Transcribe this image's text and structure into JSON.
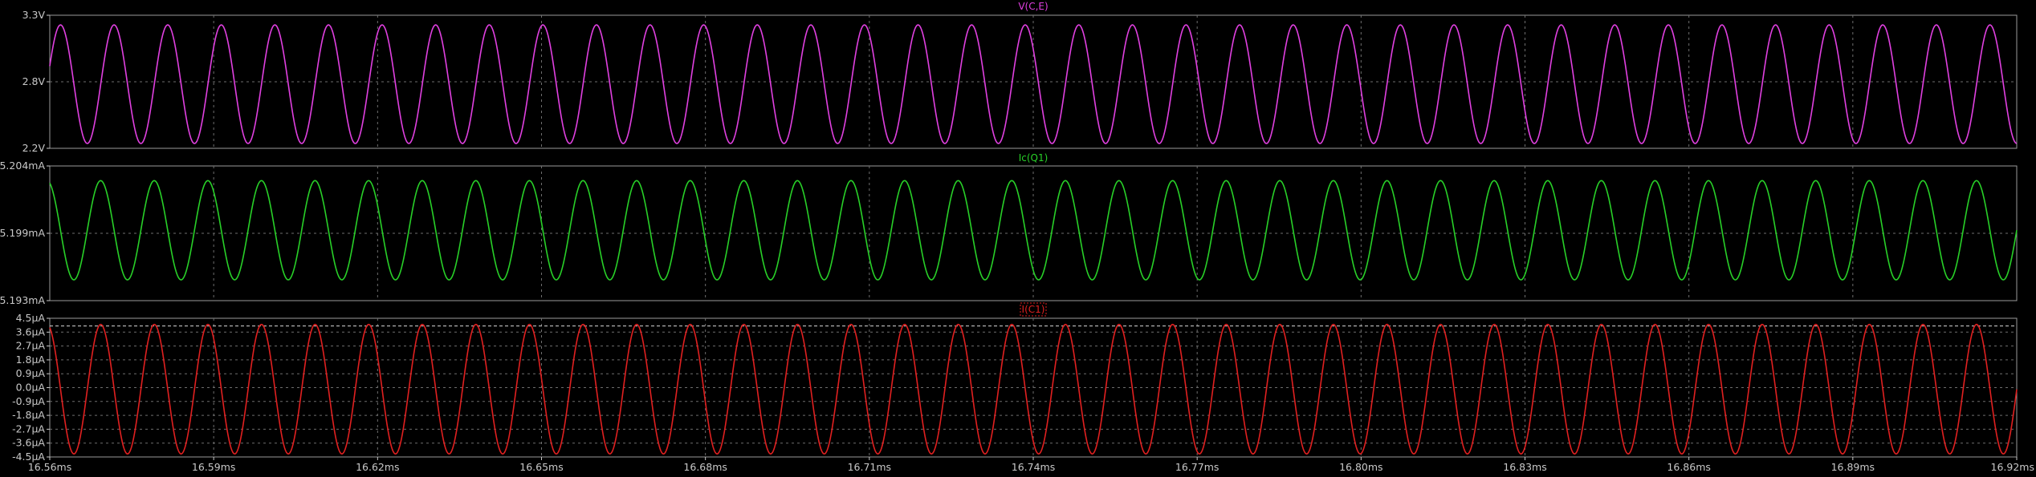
{
  "chart_data": {
    "type": "line",
    "x_ticks": [
      "16.56ms",
      "16.59ms",
      "16.62ms",
      "16.65ms",
      "16.68ms",
      "16.71ms",
      "16.74ms",
      "16.77ms",
      "16.80ms",
      "16.83ms",
      "16.86ms",
      "16.89ms",
      "16.92ms"
    ],
    "x_range_ms": [
      16.56,
      16.92
    ],
    "grid": true,
    "background": "#000000",
    "grid_color": "#6e6e6e",
    "panes": [
      {
        "title": "V(C,E)",
        "color": "#e040e0",
        "y_ticks": [
          "3.3V",
          "2.8V",
          "2.2V"
        ],
        "ylim": [
          2.2,
          3.3
        ],
        "waveform": {
          "shape": "sine",
          "min": 2.24,
          "max": 3.22,
          "cycles": 36.7,
          "start_value": 2.88,
          "start_direction": "up"
        }
      },
      {
        "title": "Ic(Q1)",
        "color": "#28d028",
        "y_ticks": [
          "5.204mA",
          "5.199mA",
          "5.193mA"
        ],
        "ylim": [
          5.193,
          5.204
        ],
        "waveform": {
          "shape": "sine",
          "min": 5.1947,
          "max": 5.2028,
          "cycles": 36.7,
          "start_value": 5.2026,
          "start_direction": "down"
        }
      },
      {
        "title": "I(C1)",
        "color": "#e02020",
        "title_boxed": true,
        "y_ticks": [
          "4.5µA",
          "3.6µA",
          "2.7µA",
          "1.8µA",
          "0.9µA",
          "0.0µA",
          "-0.9µA",
          "-1.8µA",
          "-2.7µA",
          "-3.6µA",
          "-4.5µA"
        ],
        "ylim": [
          -4.5,
          4.5
        ],
        "reference_line": 4.0,
        "waveform": {
          "shape": "sine",
          "min": -4.3,
          "max": 4.1,
          "cycles": 36.7,
          "start_value": 3.9,
          "start_direction": "down"
        }
      }
    ]
  }
}
